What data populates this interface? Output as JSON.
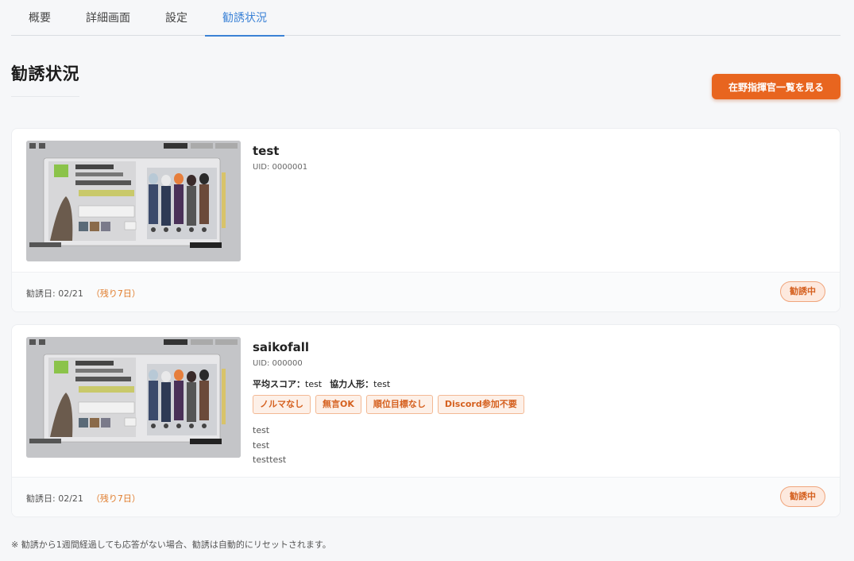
{
  "tabs": [
    "概要",
    "詳細画面",
    "設定",
    "勧誘状況"
  ],
  "active_tab": "勧誘状況",
  "page_title": "勧誘状況",
  "cta_label": "在野指揮官一覧を見る",
  "cards": [
    {
      "name": "test",
      "uid": "UID: 0000001",
      "date": "勧誘日: 02/21",
      "remaining": "（残り7日）",
      "status": "勧誘中"
    },
    {
      "name": "saikofall",
      "uid": "UID: 000000",
      "score_label": "平均スコア：",
      "score_value": "test",
      "partner_label": "協力人形：",
      "partner_value": "test",
      "tags": [
        "ノルマなし",
        "無言OK",
        "順位目標なし",
        "Discord参加不要"
      ],
      "notes": [
        "test",
        "test",
        "testtest"
      ],
      "date": "勧誘日: 02/21",
      "remaining": "（残り7日）",
      "status": "勧誘中"
    }
  ],
  "footnote": "※ 勧誘から1週間経過しても応答がない場合、勧誘は自動的にリセットされます。",
  "colors": {
    "accent": "#3b82d6",
    "cta": "#e8651f",
    "badge_text": "#d5601f"
  }
}
